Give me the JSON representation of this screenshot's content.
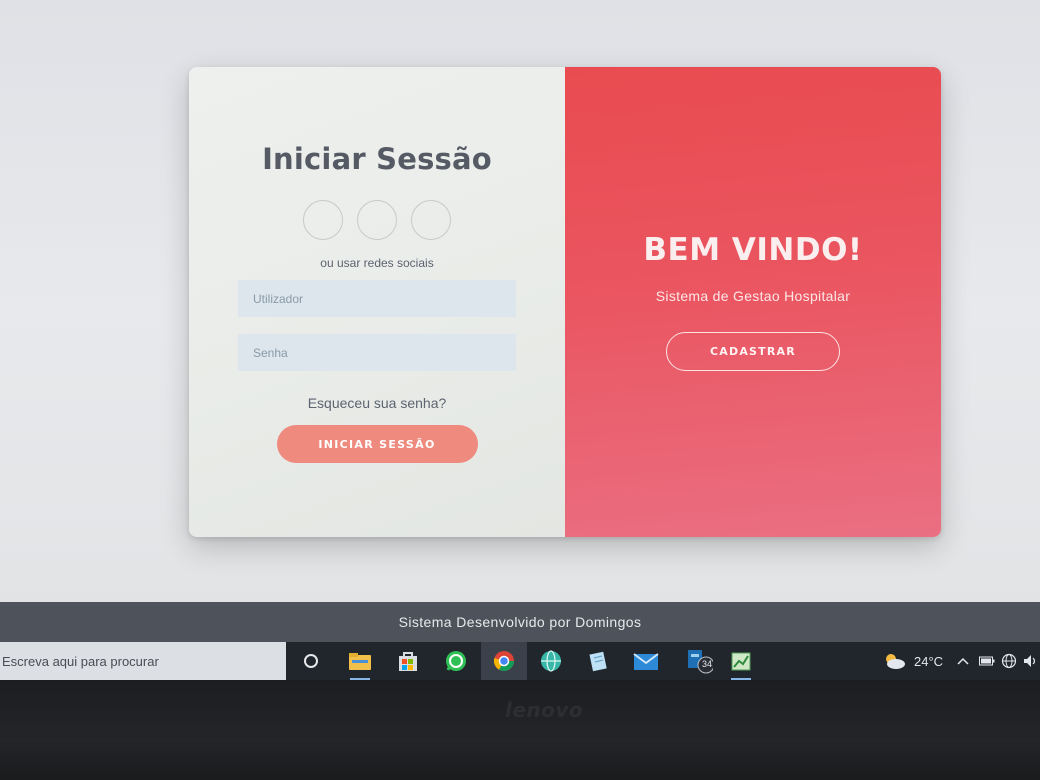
{
  "login": {
    "title": "Iniciar Sessão",
    "social_text": "ou usar redes sociais",
    "username_placeholder": "Utilizador",
    "password_placeholder": "Senha",
    "forgot_link": "Esqueceu sua senha?",
    "submit_label": "INICIAR SESSÃO"
  },
  "welcome": {
    "title": "BEM VINDO!",
    "subtitle": "Sistema de Gestao Hospitalar",
    "register_label": "CADASTRAR"
  },
  "footer": {
    "text": "Sistema Desenvolvido por Domingos"
  },
  "taskbar": {
    "search_placeholder": "Escreva aqui para procurar",
    "mail_badge": "34",
    "weather_temp": "24°C",
    "icons": [
      "cortana-circle-icon",
      "file-explorer-icon",
      "microsoft-store-icon",
      "whatsapp-icon",
      "chrome-icon",
      "globe-app-icon",
      "notepad-icon",
      "mail-icon",
      "mail-badge-app-icon",
      "spreadsheet-icon"
    ]
  },
  "bezel": {
    "brand": "lenovo"
  },
  "colors": {
    "accent_red": "#e94b50",
    "button_salmon": "#ee8a7e",
    "input_bg": "#dce6ec",
    "title_gray": "#555a64"
  }
}
